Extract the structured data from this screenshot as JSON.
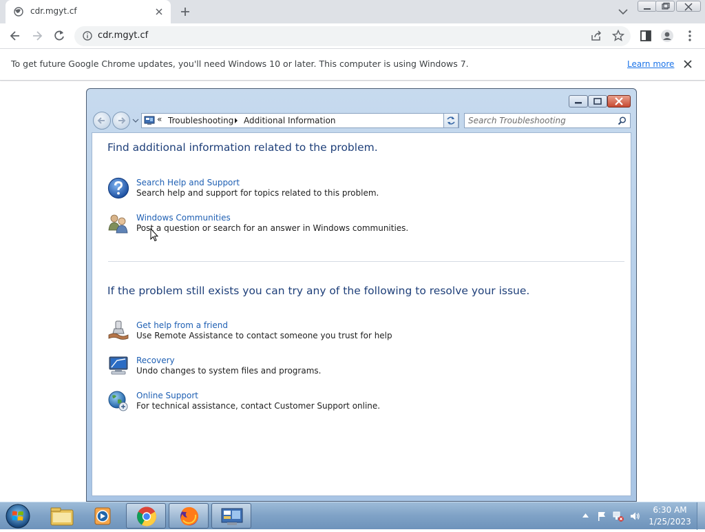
{
  "browser": {
    "tab_title": "cdr.mgyt.cf",
    "url": "cdr.mgyt.cf",
    "infobar_message": "To get future Google Chrome updates, you'll need Windows 10 or later. This computer is using Windows 7.",
    "learn_more": "Learn more"
  },
  "window": {
    "breadcrumb_root": "Troubleshooting",
    "breadcrumb_current": "Additional Information",
    "search_placeholder": "Search Troubleshooting"
  },
  "content": {
    "heading_1": "Find additional information related to the problem.",
    "section_1_items": [
      {
        "icon": "help-question-icon",
        "link": "Search Help and Support",
        "description": "Search help and support for topics related to this problem."
      },
      {
        "icon": "communities-users-icon",
        "link": "Windows Communities",
        "description": "Post a question or search for an answer in Windows communities."
      }
    ],
    "heading_2": "If the problem still exists you can try any of the following to resolve your issue.",
    "section_2_items": [
      {
        "icon": "remote-assistance-icon",
        "link": "Get help from a friend",
        "description": "Use Remote Assistance to contact someone you trust for help"
      },
      {
        "icon": "recovery-computer-icon",
        "link": "Recovery",
        "description": "Undo changes to system files and programs."
      },
      {
        "icon": "online-support-globe-icon",
        "link": "Online Support",
        "description": "For technical assistance, contact Customer Support online."
      }
    ]
  },
  "taskbar": {
    "apps": [
      "windows-explorer-icon",
      "media-player-icon",
      "chrome-icon",
      "firefox-icon",
      "control-panel-icon"
    ],
    "time": "6:30 AM",
    "date": "1/25/2023"
  },
  "colors": {
    "heading": "#1e3f79",
    "link": "#1e5fb3",
    "chrome_link": "#1a73e8",
    "taskbar": "#7fa2c6"
  }
}
